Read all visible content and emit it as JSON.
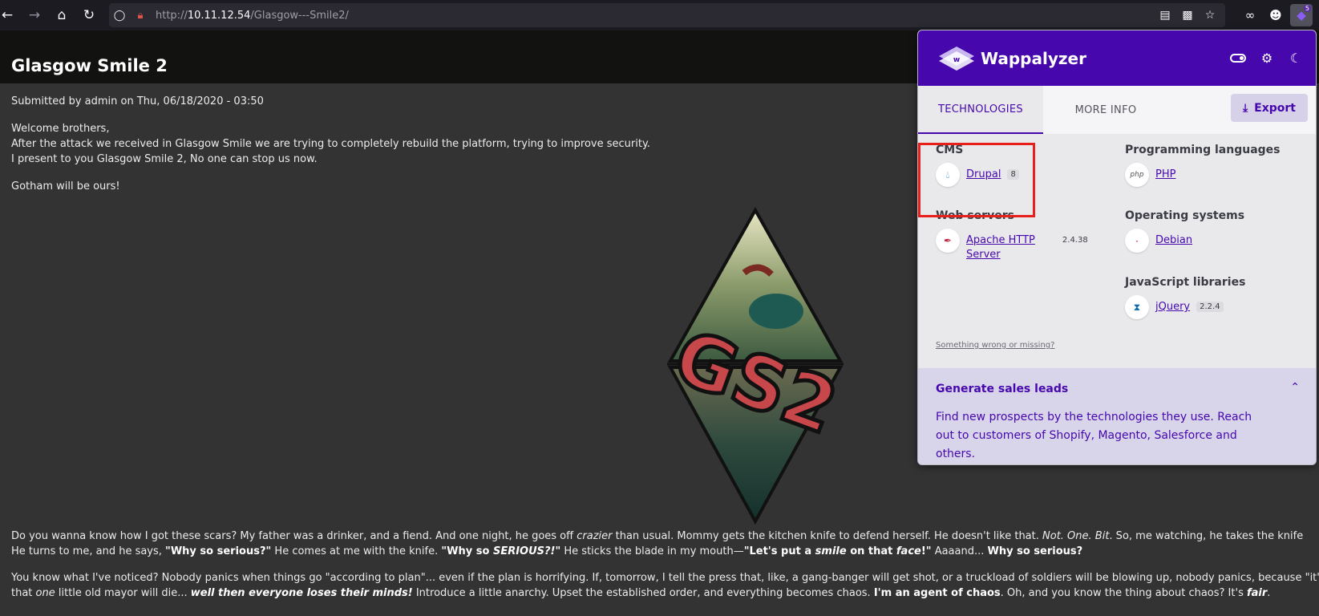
{
  "browser": {
    "url_prefix": "http://",
    "url_host": "10.11.12.54",
    "url_path": "/Glasgow---Smile2/",
    "extension_badge": "5",
    "icons": [
      "back-icon",
      "forward-icon",
      "home-icon",
      "reload-icon",
      "shield-icon",
      "lock-icon",
      "reader-icon",
      "extension-icon",
      "star-icon",
      "mask-icon",
      "account-icon",
      "wappalyzer-icon"
    ]
  },
  "page": {
    "title": "Glasgow Smile 2",
    "submitted": "Submitted by admin on Thu, 06/18/2020 - 03:50",
    "intro_1": "Welcome brothers,",
    "intro_2": "After the attack we received in Glasgow Smile we are trying to completely rebuild the platform, trying to improve security.",
    "intro_3": "I present to you Glasgow Smile 2, No one can stop us now.",
    "intro_4": "Gotham will be ours!",
    "logo_text": "GS2",
    "p1_a": "Do you wanna know how I got these scars?  My father was a drinker, and a fiend.  And one night, he goes off ",
    "p1_b": "crazier",
    "p1_c": " than usual.  Mommy gets the kitchen knife to defend herself.  He doesn't like that.  ",
    "p1_d": "Not. One. Bit",
    "p1_e": ". So, me watching, he takes the knife",
    "p2_a": "He turns to me, and he says, ",
    "p2_b": "\"Why so serious?\"",
    "p2_c": "  He comes at me with the knife. ",
    "p2_d": "\"Why so ",
    "p2_e": "SERIOUS?!",
    "p2_f": "\"",
    "p2_g": "  He sticks the blade in my mouth—",
    "p2_h": "\"Let's put a ",
    "p2_i": "smile",
    "p2_j": " on that ",
    "p2_k": "face",
    "p2_l": "!\"",
    "p2_m": "  Aaaand... ",
    "p2_n": "Why so serious?",
    "p3_a": "You know what I've noticed? Nobody panics when things go \"according to plan\"... even if the plan is horrifying. If, tomorrow, I tell the press that, like, a gang-banger will get shot, or a truckload of soldiers will be blowing up, nobody panics, because \"it's",
    "p4_a": "that ",
    "p4_b": "one",
    "p4_c": " little old mayor will die... ",
    "p4_d": "well then everyone loses their minds!",
    "p4_e": " Introduce a little anarchy. Upset the established order, and everything becomes chaos. ",
    "p4_f": "I'm an agent of chaos",
    "p4_g": ". Oh, and you know the thing about chaos? It's ",
    "p4_h": "fair",
    "p4_i": "."
  },
  "wappalyzer": {
    "name": "Wappalyzer",
    "tabs": [
      "TECHNOLOGIES",
      "MORE INFO"
    ],
    "export_label": "Export",
    "categories": [
      {
        "name": "CMS",
        "techs": [
          {
            "name": "Drupal",
            "version": "8"
          }
        ]
      },
      {
        "name": "Programming languages",
        "techs": [
          {
            "name": "PHP",
            "version": ""
          }
        ]
      },
      {
        "name": "Web servers",
        "techs": [
          {
            "name": "Apache HTTP Server",
            "name_line1": "Apache HTTP",
            "name_line2": "Server",
            "version": "2.4.38"
          }
        ]
      },
      {
        "name": "Operating systems",
        "techs": [
          {
            "name": "Debian",
            "version": ""
          }
        ]
      },
      {
        "name": "JavaScript libraries",
        "techs": [
          {
            "name": "jQuery",
            "version": "2.2.4"
          }
        ]
      }
    ],
    "feedback": "Something wrong or missing?",
    "leads_title": "Generate sales leads",
    "leads_text": "Find new prospects by the technologies they use. Reach out to customers of Shopify, Magento, Salesforce and others.",
    "brand_color": "#4608ad",
    "highlight_color": "#e8201c"
  }
}
